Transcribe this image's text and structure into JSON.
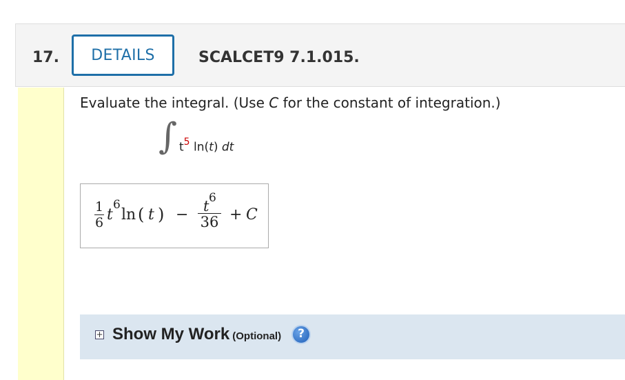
{
  "question": {
    "number": "17.",
    "details_label": "DETAILS",
    "code": "SCALCET9 7.1.015."
  },
  "prompt": {
    "before": "Evaluate the integral. (Use ",
    "var": "C",
    "after": " for the constant of integration.)"
  },
  "integral": {
    "sign": "∫",
    "base": "t",
    "power": "5",
    "func": " ln(",
    "arg": "t",
    "close": ") ",
    "dt": "dt"
  },
  "answer": {
    "coef_num": "1",
    "coef_den": "6",
    "t1": "t",
    "p1": "6",
    "ln": "ln",
    "lp": "(",
    "t2": "t",
    "rp": ")",
    "minus": "−",
    "frac2_t": "t",
    "frac2_p": "6",
    "frac2_den": "36",
    "plus": "+",
    "C": "C"
  },
  "show_work": {
    "toggle_symbol": "+",
    "label": "Show My Work",
    "optional": "(Optional)",
    "help_symbol": "?"
  },
  "colors": {
    "details_border": "#1e6fa8",
    "sidebar": "#ffffcc",
    "show_work_bg": "#dbe6f0",
    "help_icon": "#1f5fb8"
  }
}
